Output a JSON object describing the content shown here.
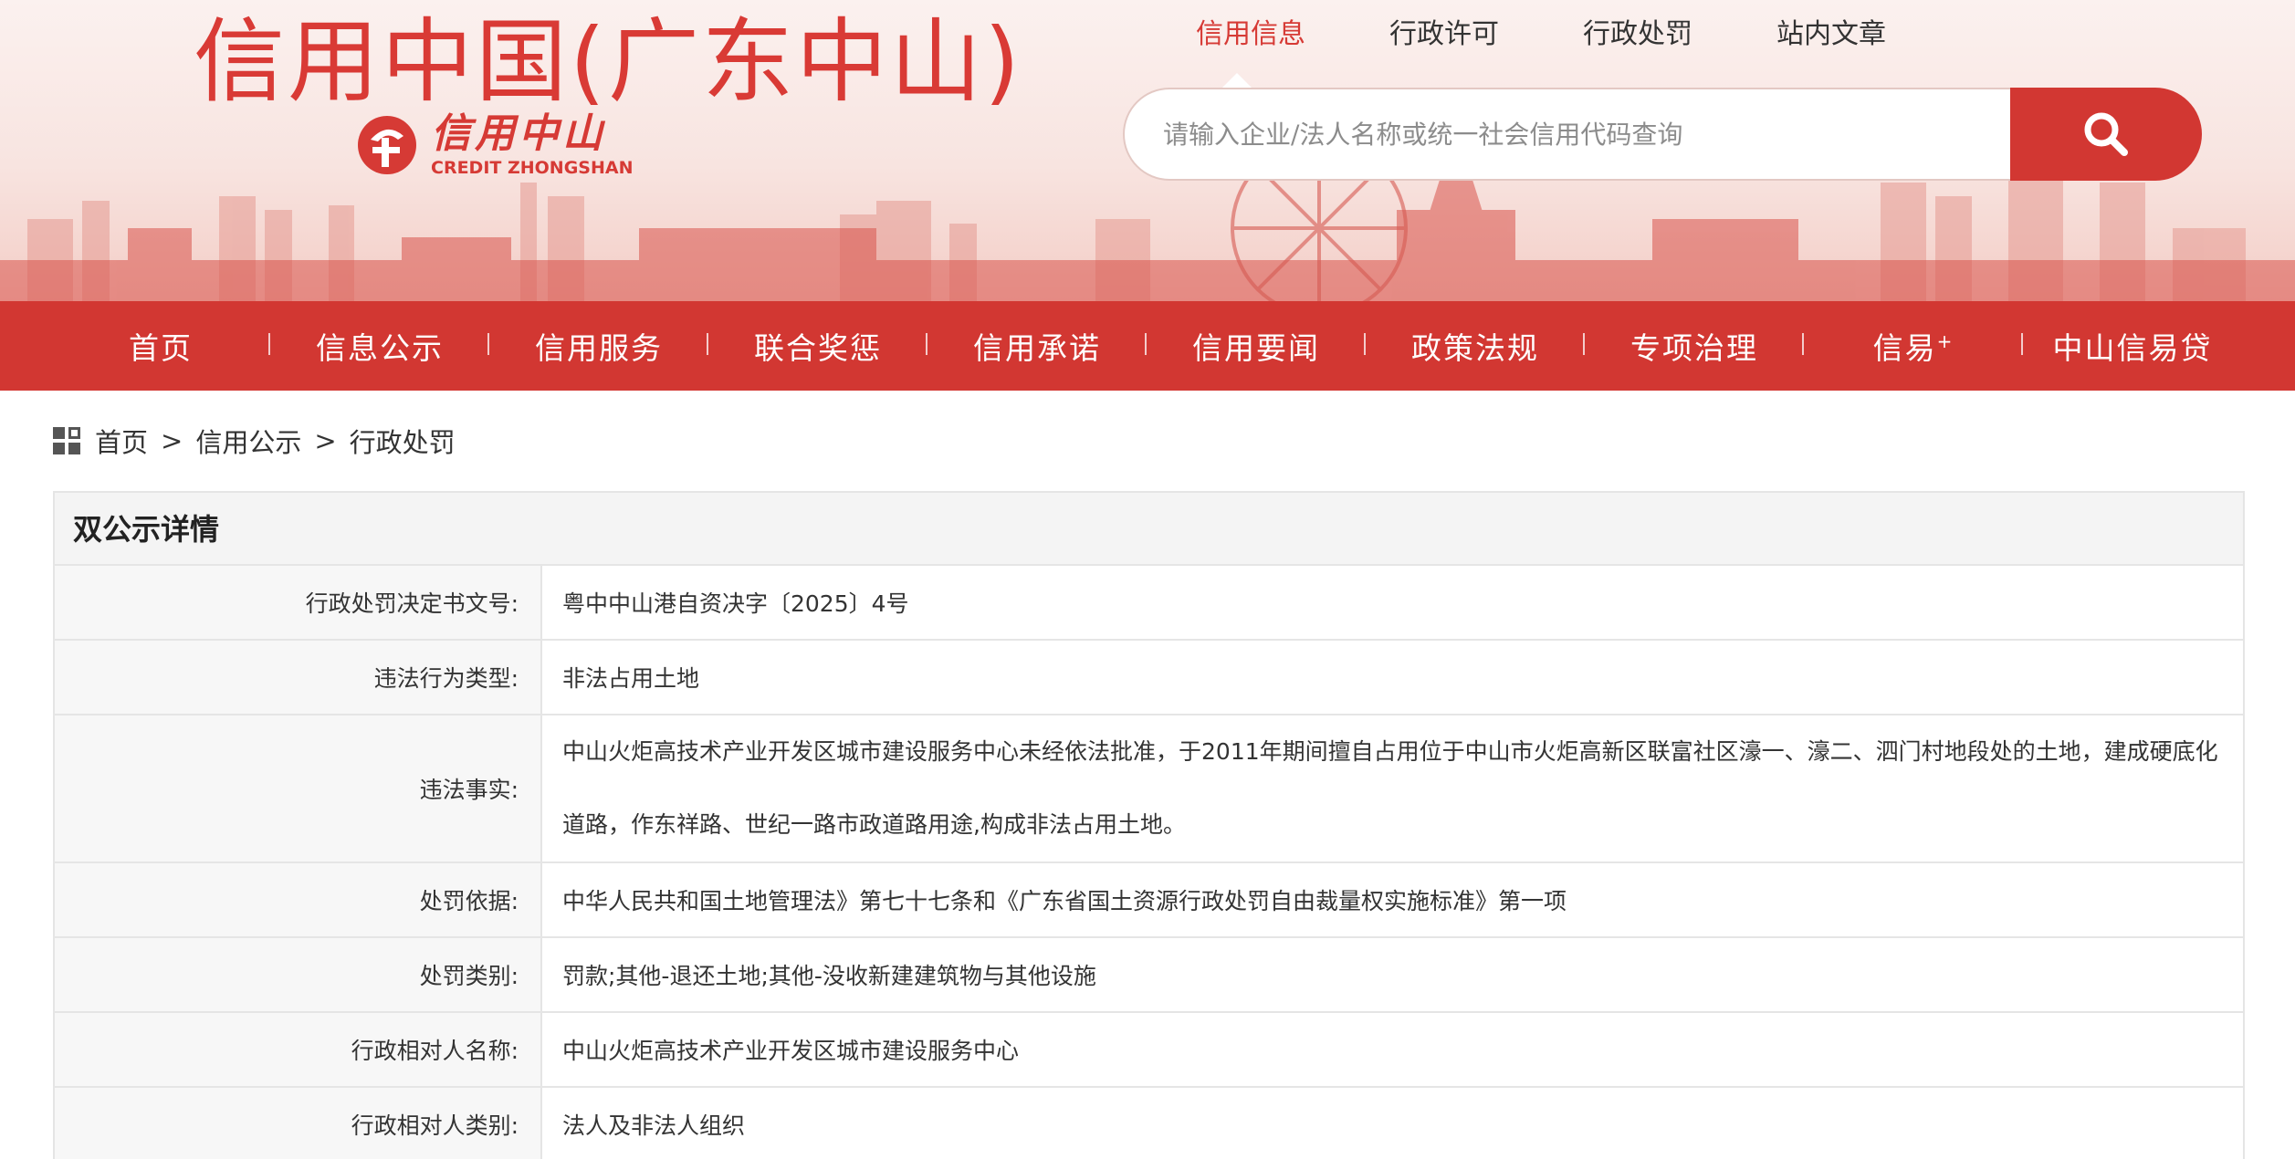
{
  "header": {
    "site_title": "信用中国(广东中山)",
    "logo_cn": "信用中山",
    "logo_en": "CREDIT ZHONGSHAN",
    "brand_color": "#d23732"
  },
  "top_nav": {
    "items": [
      {
        "label": "信用信息",
        "active": true
      },
      {
        "label": "行政许可",
        "active": false
      },
      {
        "label": "行政处罚",
        "active": false
      },
      {
        "label": "站内文章",
        "active": false
      }
    ]
  },
  "search": {
    "placeholder": "请输入企业/法人名称或统一社会信用代码查询",
    "value": "",
    "button_icon": "search-icon"
  },
  "main_nav": {
    "items": [
      {
        "label": "首页"
      },
      {
        "label": "信息公示"
      },
      {
        "label": "信用服务"
      },
      {
        "label": "联合奖惩"
      },
      {
        "label": "信用承诺"
      },
      {
        "label": "信用要闻"
      },
      {
        "label": "政策法规"
      },
      {
        "label": "专项治理"
      },
      {
        "label": "信易",
        "suffix": "+"
      },
      {
        "label": "中山信易贷"
      }
    ]
  },
  "breadcrumb": {
    "icon": "grid-icon",
    "items": [
      "首页",
      "信用公示",
      "行政处罚"
    ],
    "separator": ">"
  },
  "detail": {
    "title": "双公示详情",
    "rows": [
      {
        "label": "行政处罚决定书文号:",
        "value": "粤中中山港自资决字〔2025〕4号"
      },
      {
        "label": "违法行为类型:",
        "value": "非法占用土地"
      },
      {
        "label": "违法事实:",
        "value": "中山火炬高技术产业开发区城市建设服务中心未经依法批准，于2011年期间擅自占用位于中山市火炬高新区联富社区濠一、濠二、泗门村地段处的土地，建成硬底化道路，作东祥路、世纪一路市政道路用途,构成非法占用土地。"
      },
      {
        "label": "处罚依据:",
        "value": "中华人民共和国土地管理法》第七十七条和《广东省国土资源行政处罚自由裁量权实施标准》第一项"
      },
      {
        "label": "处罚类别:",
        "value": "罚款;其他-退还土地;其他-没收新建建筑物与其他设施"
      },
      {
        "label": "行政相对人名称:",
        "value": "中山火炬高技术产业开发区城市建设服务中心"
      },
      {
        "label": "行政相对人类别:",
        "value": "法人及非法人组织"
      }
    ]
  }
}
